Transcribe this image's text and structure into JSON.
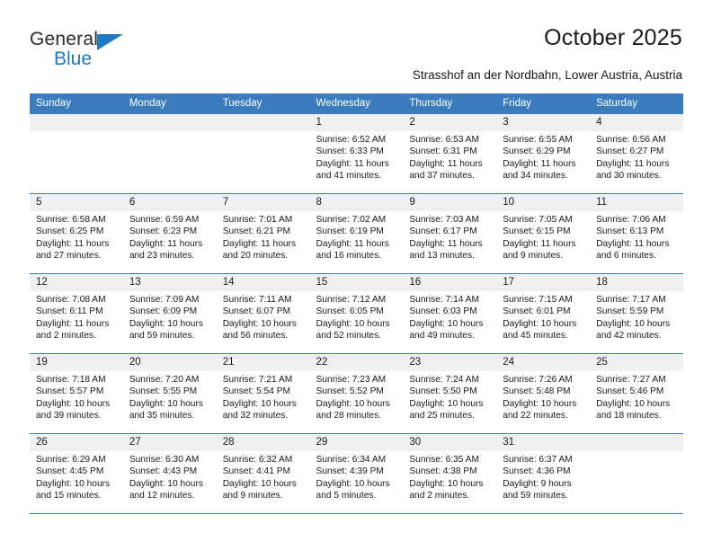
{
  "brand": {
    "word_one": "General",
    "word_two": "Blue",
    "triangle_icon": "triangle-icon",
    "accent_color": "#1d79c4"
  },
  "header": {
    "title": "October 2025",
    "subtitle": "Strasshof an der Nordbahn, Lower Austria, Austria"
  },
  "theme": {
    "header_blue": "#3a7cbe",
    "daynum_gray": "#f0f0f0",
    "text": "#1a1a1a"
  },
  "calendar": {
    "weekday_headers": [
      "Sunday",
      "Monday",
      "Tuesday",
      "Wednesday",
      "Thursday",
      "Friday",
      "Saturday"
    ],
    "labels": {
      "sunrise": "Sunrise:",
      "sunset": "Sunset:",
      "daylight": "Daylight:"
    },
    "weeks": [
      [
        {
          "day": "",
          "blank": true
        },
        {
          "day": "",
          "blank": true
        },
        {
          "day": "",
          "blank": true
        },
        {
          "day": "1",
          "sunrise": "Sunrise: 6:52 AM",
          "sunset": "Sunset: 6:33 PM",
          "daylight": "Daylight: 11 hours and 41 minutes."
        },
        {
          "day": "2",
          "sunrise": "Sunrise: 6:53 AM",
          "sunset": "Sunset: 6:31 PM",
          "daylight": "Daylight: 11 hours and 37 minutes."
        },
        {
          "day": "3",
          "sunrise": "Sunrise: 6:55 AM",
          "sunset": "Sunset: 6:29 PM",
          "daylight": "Daylight: 11 hours and 34 minutes."
        },
        {
          "day": "4",
          "sunrise": "Sunrise: 6:56 AM",
          "sunset": "Sunset: 6:27 PM",
          "daylight": "Daylight: 11 hours and 30 minutes."
        }
      ],
      [
        {
          "day": "5",
          "sunrise": "Sunrise: 6:58 AM",
          "sunset": "Sunset: 6:25 PM",
          "daylight": "Daylight: 11 hours and 27 minutes."
        },
        {
          "day": "6",
          "sunrise": "Sunrise: 6:59 AM",
          "sunset": "Sunset: 6:23 PM",
          "daylight": "Daylight: 11 hours and 23 minutes."
        },
        {
          "day": "7",
          "sunrise": "Sunrise: 7:01 AM",
          "sunset": "Sunset: 6:21 PM",
          "daylight": "Daylight: 11 hours and 20 minutes."
        },
        {
          "day": "8",
          "sunrise": "Sunrise: 7:02 AM",
          "sunset": "Sunset: 6:19 PM",
          "daylight": "Daylight: 11 hours and 16 minutes."
        },
        {
          "day": "9",
          "sunrise": "Sunrise: 7:03 AM",
          "sunset": "Sunset: 6:17 PM",
          "daylight": "Daylight: 11 hours and 13 minutes."
        },
        {
          "day": "10",
          "sunrise": "Sunrise: 7:05 AM",
          "sunset": "Sunset: 6:15 PM",
          "daylight": "Daylight: 11 hours and 9 minutes."
        },
        {
          "day": "11",
          "sunrise": "Sunrise: 7:06 AM",
          "sunset": "Sunset: 6:13 PM",
          "daylight": "Daylight: 11 hours and 6 minutes."
        }
      ],
      [
        {
          "day": "12",
          "sunrise": "Sunrise: 7:08 AM",
          "sunset": "Sunset: 6:11 PM",
          "daylight": "Daylight: 11 hours and 2 minutes."
        },
        {
          "day": "13",
          "sunrise": "Sunrise: 7:09 AM",
          "sunset": "Sunset: 6:09 PM",
          "daylight": "Daylight: 10 hours and 59 minutes."
        },
        {
          "day": "14",
          "sunrise": "Sunrise: 7:11 AM",
          "sunset": "Sunset: 6:07 PM",
          "daylight": "Daylight: 10 hours and 56 minutes."
        },
        {
          "day": "15",
          "sunrise": "Sunrise: 7:12 AM",
          "sunset": "Sunset: 6:05 PM",
          "daylight": "Daylight: 10 hours and 52 minutes."
        },
        {
          "day": "16",
          "sunrise": "Sunrise: 7:14 AM",
          "sunset": "Sunset: 6:03 PM",
          "daylight": "Daylight: 10 hours and 49 minutes."
        },
        {
          "day": "17",
          "sunrise": "Sunrise: 7:15 AM",
          "sunset": "Sunset: 6:01 PM",
          "daylight": "Daylight: 10 hours and 45 minutes."
        },
        {
          "day": "18",
          "sunrise": "Sunrise: 7:17 AM",
          "sunset": "Sunset: 5:59 PM",
          "daylight": "Daylight: 10 hours and 42 minutes."
        }
      ],
      [
        {
          "day": "19",
          "sunrise": "Sunrise: 7:18 AM",
          "sunset": "Sunset: 5:57 PM",
          "daylight": "Daylight: 10 hours and 39 minutes."
        },
        {
          "day": "20",
          "sunrise": "Sunrise: 7:20 AM",
          "sunset": "Sunset: 5:55 PM",
          "daylight": "Daylight: 10 hours and 35 minutes."
        },
        {
          "day": "21",
          "sunrise": "Sunrise: 7:21 AM",
          "sunset": "Sunset: 5:54 PM",
          "daylight": "Daylight: 10 hours and 32 minutes."
        },
        {
          "day": "22",
          "sunrise": "Sunrise: 7:23 AM",
          "sunset": "Sunset: 5:52 PM",
          "daylight": "Daylight: 10 hours and 28 minutes."
        },
        {
          "day": "23",
          "sunrise": "Sunrise: 7:24 AM",
          "sunset": "Sunset: 5:50 PM",
          "daylight": "Daylight: 10 hours and 25 minutes."
        },
        {
          "day": "24",
          "sunrise": "Sunrise: 7:26 AM",
          "sunset": "Sunset: 5:48 PM",
          "daylight": "Daylight: 10 hours and 22 minutes."
        },
        {
          "day": "25",
          "sunrise": "Sunrise: 7:27 AM",
          "sunset": "Sunset: 5:46 PM",
          "daylight": "Daylight: 10 hours and 18 minutes."
        }
      ],
      [
        {
          "day": "26",
          "sunrise": "Sunrise: 6:29 AM",
          "sunset": "Sunset: 4:45 PM",
          "daylight": "Daylight: 10 hours and 15 minutes."
        },
        {
          "day": "27",
          "sunrise": "Sunrise: 6:30 AM",
          "sunset": "Sunset: 4:43 PM",
          "daylight": "Daylight: 10 hours and 12 minutes."
        },
        {
          "day": "28",
          "sunrise": "Sunrise: 6:32 AM",
          "sunset": "Sunset: 4:41 PM",
          "daylight": "Daylight: 10 hours and 9 minutes."
        },
        {
          "day": "29",
          "sunrise": "Sunrise: 6:34 AM",
          "sunset": "Sunset: 4:39 PM",
          "daylight": "Daylight: 10 hours and 5 minutes."
        },
        {
          "day": "30",
          "sunrise": "Sunrise: 6:35 AM",
          "sunset": "Sunset: 4:38 PM",
          "daylight": "Daylight: 10 hours and 2 minutes."
        },
        {
          "day": "31",
          "sunrise": "Sunrise: 6:37 AM",
          "sunset": "Sunset: 4:36 PM",
          "daylight": "Daylight: 9 hours and 59 minutes."
        },
        {
          "day": "",
          "blank": true
        }
      ]
    ]
  }
}
